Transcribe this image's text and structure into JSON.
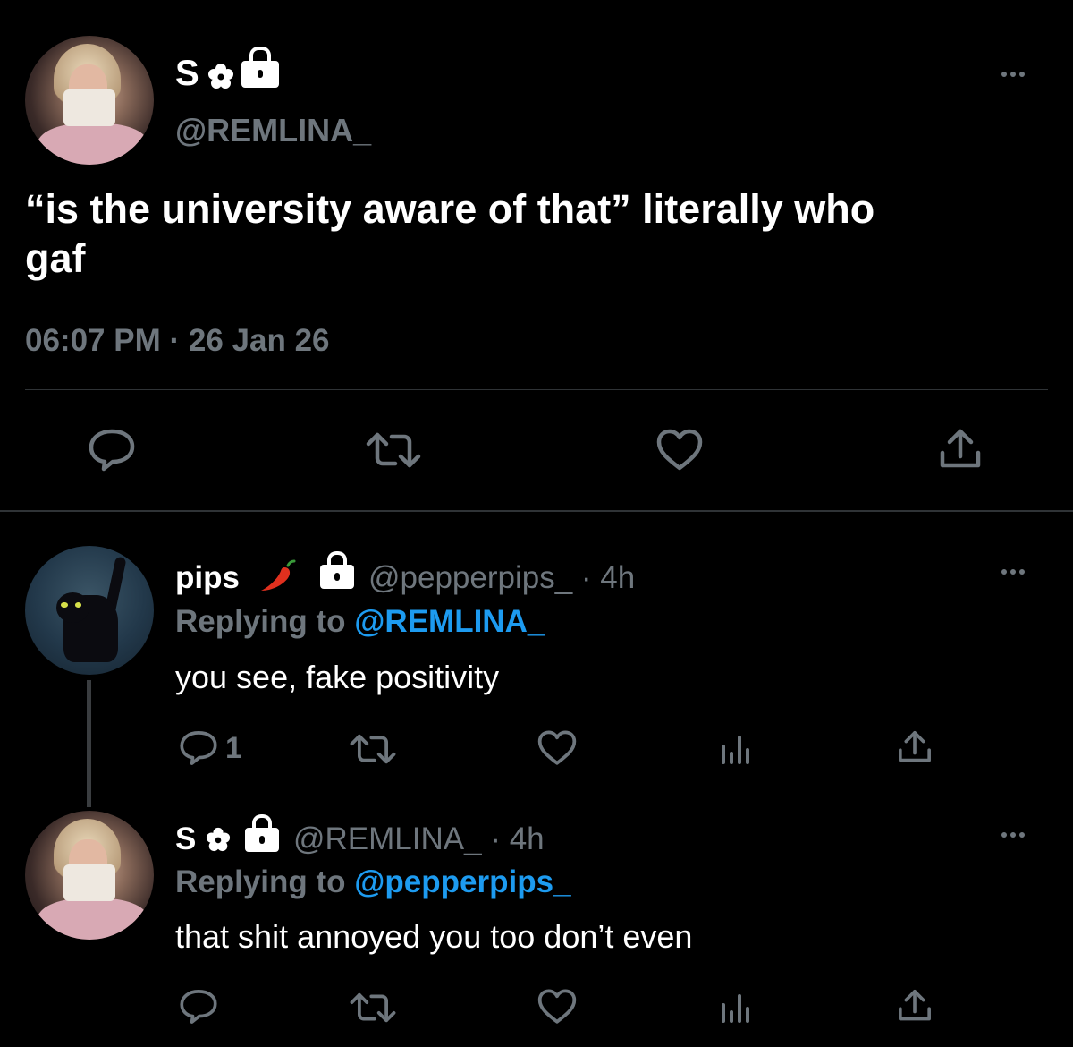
{
  "main_tweet": {
    "display_name": "S",
    "handle": "@REMLINA_",
    "text_line1": "“is the university aware of that” literally who",
    "text_line2": "gaf",
    "time": "06:07 PM",
    "separator": "·",
    "date": "26 Jan 26",
    "avatar_icon": "profile-photo-girl-with-mug",
    "name_icons": [
      "flower-icon",
      "lock-icon"
    ]
  },
  "reply1": {
    "display_name": "pips",
    "name_icons": [
      "chili-pepper-icon",
      "lock-icon"
    ],
    "handle": "@pepperpips_",
    "age": "· 4h",
    "replying_prefix": "Replying to",
    "replying_handle": "@REMLINA_",
    "text": "you see, fake positivity",
    "reply_count": "1"
  },
  "reply2": {
    "display_name": "S",
    "name_icons": [
      "flower-icon",
      "lock-icon"
    ],
    "handle": "@REMLINA_",
    "age": "· 4h",
    "replying_prefix": "Replying to",
    "replying_handle": "@pepperpips_",
    "text": "that shit annoyed you too don’t even"
  },
  "colors": {
    "background": "#000000",
    "text": "#ffffff",
    "secondary": "#6e767d",
    "link": "#1d9bf0",
    "divider": "#2f3336",
    "chili": "#e0301e"
  }
}
